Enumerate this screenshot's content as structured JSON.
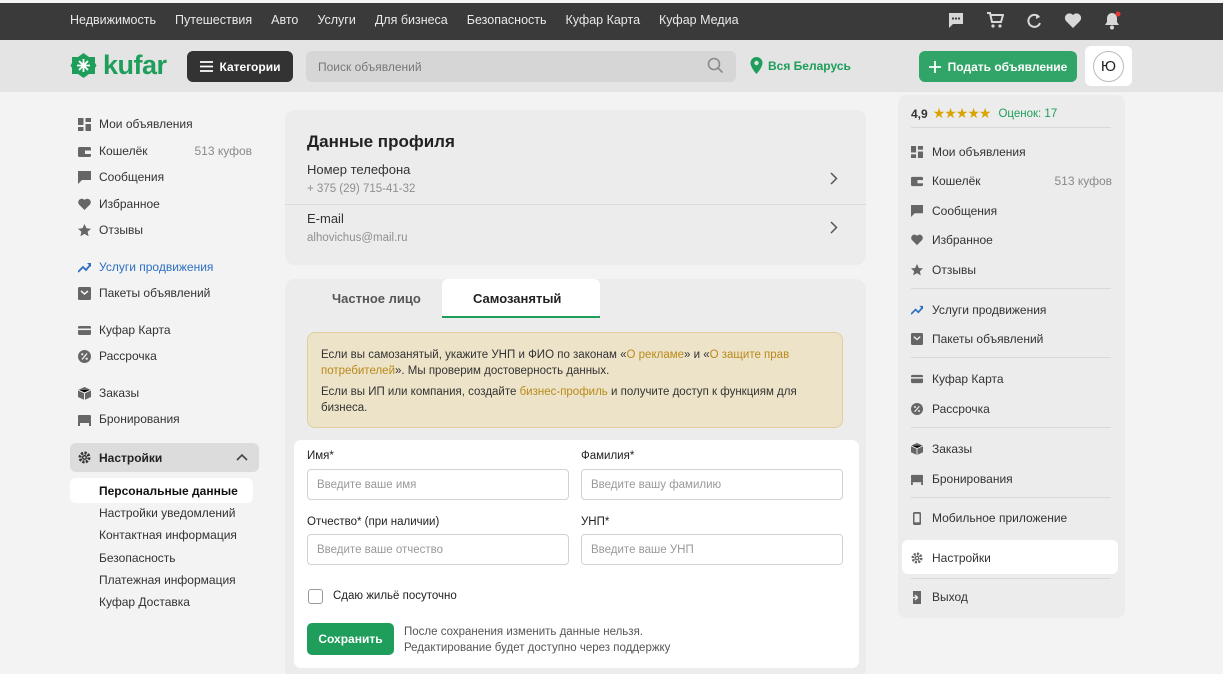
{
  "topbar": {
    "links": [
      "Недвижимость",
      "Путешествия",
      "Авто",
      "Услуги",
      "Для бизнеса",
      "Безопасность",
      "Куфар Карта",
      "Куфар Медиа"
    ],
    "icons": [
      "chat-icon",
      "cart-icon",
      "compare-icon",
      "heart-icon",
      "bell-icon"
    ]
  },
  "header": {
    "logo": "kufar",
    "categories_label": "Категории",
    "search_placeholder": "Поиск объявлений",
    "region": "Вся Беларусь",
    "post_label": "Подать объявление",
    "avatar_letter": "Ю"
  },
  "left_nav": {
    "items": [
      {
        "label": "Мои объявления",
        "icon": "grid-icon"
      },
      {
        "label": "Кошелёк",
        "icon": "wallet-icon",
        "count": "513 куфов"
      },
      {
        "label": "Сообщения",
        "icon": "message-icon"
      },
      {
        "label": "Избранное",
        "icon": "heart-icon"
      },
      {
        "label": "Отзывы",
        "icon": "star-icon"
      },
      {
        "label": "Услуги продвижения",
        "icon": "trend-icon"
      },
      {
        "label": "Пакеты объявлений",
        "icon": "package-icon"
      },
      {
        "label": "Куфар Карта",
        "icon": "card-icon"
      },
      {
        "label": "Рассрочка",
        "icon": "percent-icon"
      },
      {
        "label": "Заказы",
        "icon": "box-icon"
      },
      {
        "label": "Бронирования",
        "icon": "bed-icon"
      }
    ],
    "settings_label": "Настройки",
    "settings_sub": [
      "Персональные данные",
      "Настройки уведомлений",
      "Контактная информация",
      "Безопасность",
      "Платежная информация",
      "Куфар Доставка"
    ]
  },
  "profile": {
    "title": "Данные профиля",
    "phone_label": "Номер телефона",
    "phone_value": "+ 375 (29) 715-41-32",
    "email_label": "E-mail",
    "email_value": "alhovichus@mail.ru"
  },
  "tabs": {
    "private": "Частное лицо",
    "self_employed": "Самозанятый"
  },
  "notice": {
    "p1_a": "Если вы самозанятый, укажите УНП и ФИО по законам «",
    "p1_link1": "О рекламе",
    "p1_b": "» и «",
    "p1_link2": "О защите прав потребителей",
    "p1_c": "». Мы проверим достоверность данных.",
    "p2_a": "Если вы ИП или компания, создайте ",
    "p2_link": "бизнес-профиль",
    "p2_b": " и получите доступ к функциям для бизнеса."
  },
  "form": {
    "first_name_label": "Имя*",
    "first_name_placeholder": "Введите ваше имя",
    "last_name_label": "Фамилия*",
    "last_name_placeholder": "Введите вашу фамилию",
    "patronymic_label": "Отчество* (при наличии)",
    "patronymic_placeholder": "Введите ваше отчество",
    "unp_label": "УНП*",
    "unp_placeholder": "Введите ваше УНП",
    "daily_rent_label": "Сдаю жильё посуточно",
    "save_label": "Сохранить",
    "save_note_1": "После сохранения изменить данные нельзя.",
    "save_note_2": "Редактирование будет доступно через поддержку"
  },
  "user_menu": {
    "rating": "4,9",
    "stars": "★★★★★",
    "reviews": "Оценок: 17",
    "items": [
      {
        "label": "Мои объявления",
        "icon": "grid-icon"
      },
      {
        "label": "Кошелёк",
        "icon": "wallet-icon",
        "count": "513 куфов"
      },
      {
        "label": "Сообщения",
        "icon": "message-icon"
      },
      {
        "label": "Избранное",
        "icon": "heart-icon"
      },
      {
        "label": "Отзывы",
        "icon": "star-icon"
      },
      {
        "label": "Услуги продвижения",
        "icon": "trend-icon"
      },
      {
        "label": "Пакеты объявлений",
        "icon": "package-icon"
      },
      {
        "label": "Куфар Карта",
        "icon": "card-icon"
      },
      {
        "label": "Рассрочка",
        "icon": "percent-icon"
      },
      {
        "label": "Заказы",
        "icon": "box-icon"
      },
      {
        "label": "Бронирования",
        "icon": "bed-icon"
      },
      {
        "label": "Мобильное приложение",
        "icon": "phone-icon"
      },
      {
        "label": "Настройки",
        "icon": "gear-icon"
      },
      {
        "label": "Выход",
        "icon": "logout-icon"
      }
    ]
  },
  "colors": {
    "brand_green": "#1e9e5a",
    "promo_blue": "#2d6fc1",
    "star_gold": "#d9a300",
    "topbar_bg": "#3a3a3a"
  }
}
